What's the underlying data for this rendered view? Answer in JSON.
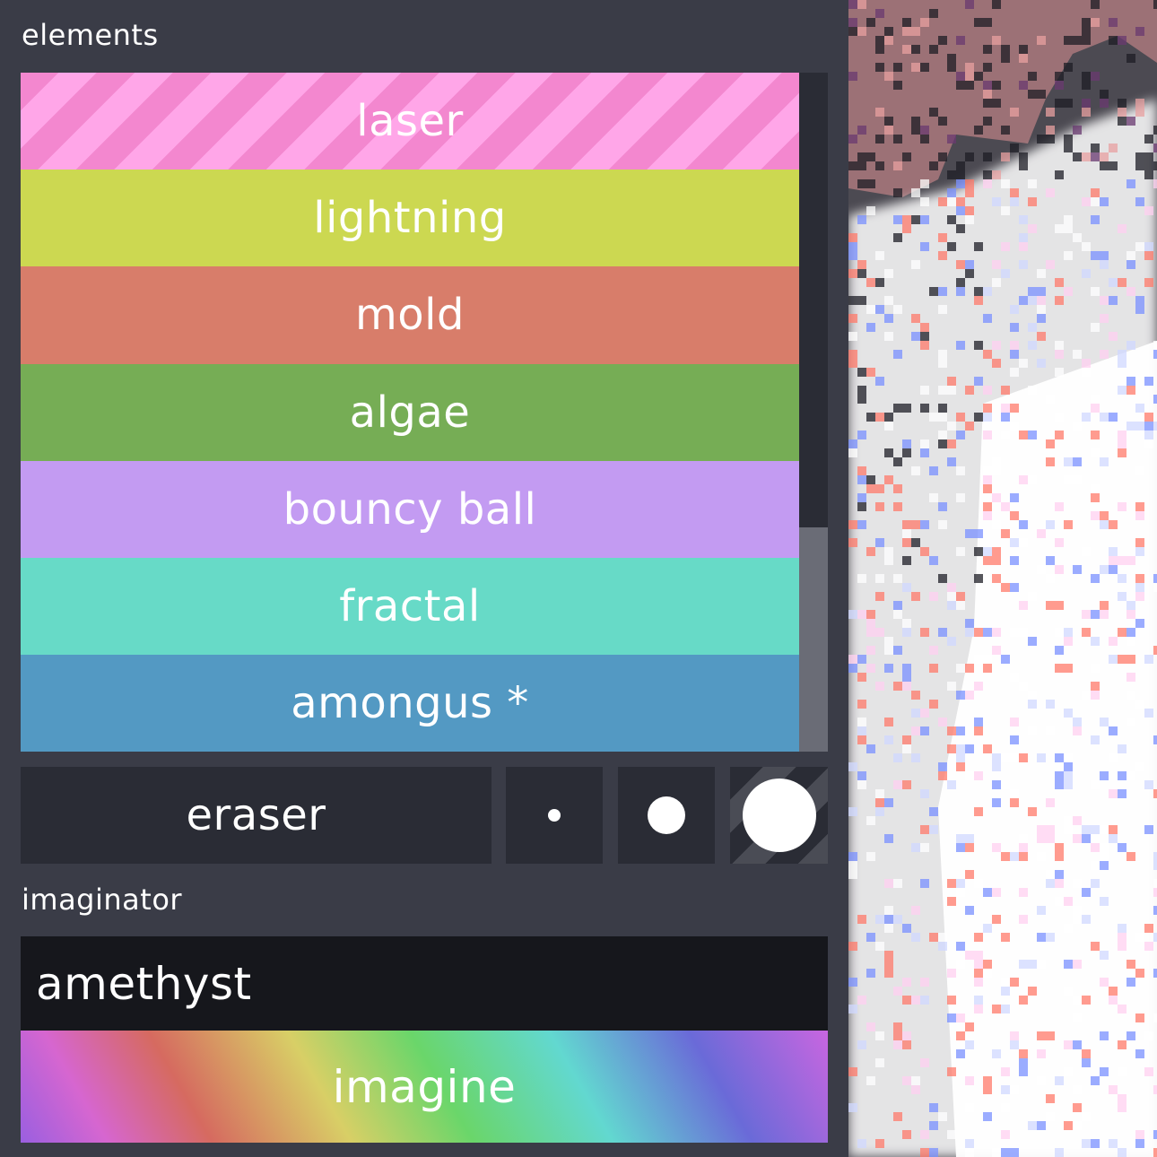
{
  "panel": {
    "elements_label": "elements",
    "imaginator_label": "imaginator"
  },
  "elements": [
    {
      "label": "laser",
      "color": "#f387cf",
      "stripe": "#ffa6e8"
    },
    {
      "label": "lightning",
      "color": "#ccd851"
    },
    {
      "label": "mold",
      "color": "#d87d6a"
    },
    {
      "label": "algae",
      "color": "#76ad55"
    },
    {
      "label": "bouncy ball",
      "color": "#c39bf2"
    },
    {
      "label": "fractal",
      "color": "#67dac7"
    },
    {
      "label": "amongus *",
      "color": "#5399c3"
    }
  ],
  "tools": {
    "eraser_label": "eraser"
  },
  "imaginator": {
    "input_value": "amethyst",
    "button_label": "imagine"
  }
}
